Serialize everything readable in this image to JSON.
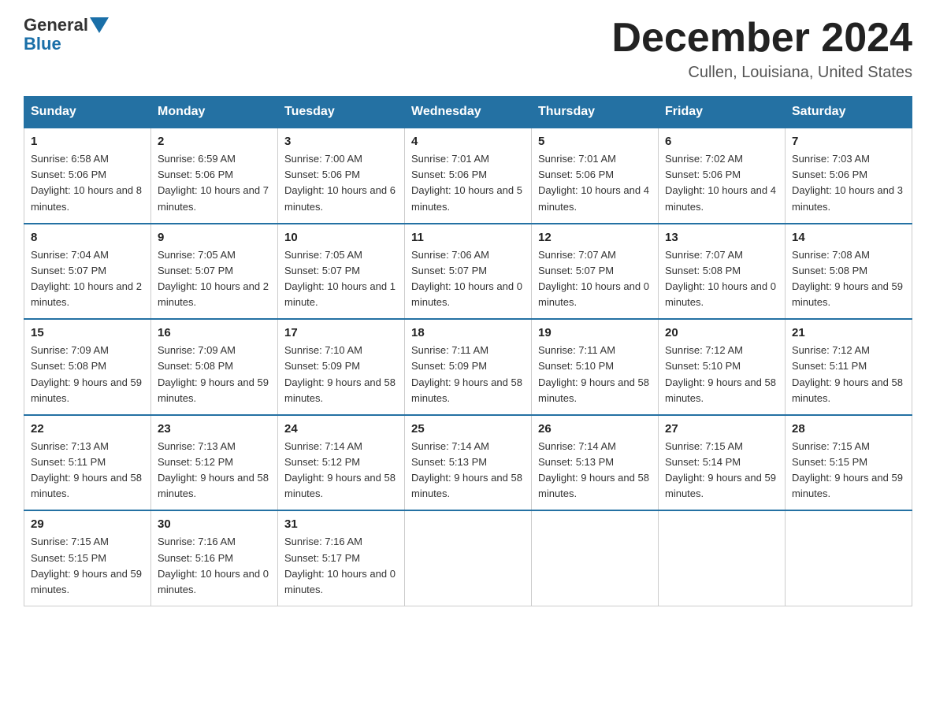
{
  "header": {
    "logo_general": "General",
    "logo_blue": "Blue",
    "title": "December 2024",
    "subtitle": "Cullen, Louisiana, United States"
  },
  "days_of_week": [
    "Sunday",
    "Monday",
    "Tuesday",
    "Wednesday",
    "Thursday",
    "Friday",
    "Saturday"
  ],
  "weeks": [
    [
      {
        "day": "1",
        "sunrise": "6:58 AM",
        "sunset": "5:06 PM",
        "daylight": "10 hours and 8 minutes."
      },
      {
        "day": "2",
        "sunrise": "6:59 AM",
        "sunset": "5:06 PM",
        "daylight": "10 hours and 7 minutes."
      },
      {
        "day": "3",
        "sunrise": "7:00 AM",
        "sunset": "5:06 PM",
        "daylight": "10 hours and 6 minutes."
      },
      {
        "day": "4",
        "sunrise": "7:01 AM",
        "sunset": "5:06 PM",
        "daylight": "10 hours and 5 minutes."
      },
      {
        "day": "5",
        "sunrise": "7:01 AM",
        "sunset": "5:06 PM",
        "daylight": "10 hours and 4 minutes."
      },
      {
        "day": "6",
        "sunrise": "7:02 AM",
        "sunset": "5:06 PM",
        "daylight": "10 hours and 4 minutes."
      },
      {
        "day": "7",
        "sunrise": "7:03 AM",
        "sunset": "5:06 PM",
        "daylight": "10 hours and 3 minutes."
      }
    ],
    [
      {
        "day": "8",
        "sunrise": "7:04 AM",
        "sunset": "5:07 PM",
        "daylight": "10 hours and 2 minutes."
      },
      {
        "day": "9",
        "sunrise": "7:05 AM",
        "sunset": "5:07 PM",
        "daylight": "10 hours and 2 minutes."
      },
      {
        "day": "10",
        "sunrise": "7:05 AM",
        "sunset": "5:07 PM",
        "daylight": "10 hours and 1 minute."
      },
      {
        "day": "11",
        "sunrise": "7:06 AM",
        "sunset": "5:07 PM",
        "daylight": "10 hours and 0 minutes."
      },
      {
        "day": "12",
        "sunrise": "7:07 AM",
        "sunset": "5:07 PM",
        "daylight": "10 hours and 0 minutes."
      },
      {
        "day": "13",
        "sunrise": "7:07 AM",
        "sunset": "5:08 PM",
        "daylight": "10 hours and 0 minutes."
      },
      {
        "day": "14",
        "sunrise": "7:08 AM",
        "sunset": "5:08 PM",
        "daylight": "9 hours and 59 minutes."
      }
    ],
    [
      {
        "day": "15",
        "sunrise": "7:09 AM",
        "sunset": "5:08 PM",
        "daylight": "9 hours and 59 minutes."
      },
      {
        "day": "16",
        "sunrise": "7:09 AM",
        "sunset": "5:08 PM",
        "daylight": "9 hours and 59 minutes."
      },
      {
        "day": "17",
        "sunrise": "7:10 AM",
        "sunset": "5:09 PM",
        "daylight": "9 hours and 58 minutes."
      },
      {
        "day": "18",
        "sunrise": "7:11 AM",
        "sunset": "5:09 PM",
        "daylight": "9 hours and 58 minutes."
      },
      {
        "day": "19",
        "sunrise": "7:11 AM",
        "sunset": "5:10 PM",
        "daylight": "9 hours and 58 minutes."
      },
      {
        "day": "20",
        "sunrise": "7:12 AM",
        "sunset": "5:10 PM",
        "daylight": "9 hours and 58 minutes."
      },
      {
        "day": "21",
        "sunrise": "7:12 AM",
        "sunset": "5:11 PM",
        "daylight": "9 hours and 58 minutes."
      }
    ],
    [
      {
        "day": "22",
        "sunrise": "7:13 AM",
        "sunset": "5:11 PM",
        "daylight": "9 hours and 58 minutes."
      },
      {
        "day": "23",
        "sunrise": "7:13 AM",
        "sunset": "5:12 PM",
        "daylight": "9 hours and 58 minutes."
      },
      {
        "day": "24",
        "sunrise": "7:14 AM",
        "sunset": "5:12 PM",
        "daylight": "9 hours and 58 minutes."
      },
      {
        "day": "25",
        "sunrise": "7:14 AM",
        "sunset": "5:13 PM",
        "daylight": "9 hours and 58 minutes."
      },
      {
        "day": "26",
        "sunrise": "7:14 AM",
        "sunset": "5:13 PM",
        "daylight": "9 hours and 58 minutes."
      },
      {
        "day": "27",
        "sunrise": "7:15 AM",
        "sunset": "5:14 PM",
        "daylight": "9 hours and 59 minutes."
      },
      {
        "day": "28",
        "sunrise": "7:15 AM",
        "sunset": "5:15 PM",
        "daylight": "9 hours and 59 minutes."
      }
    ],
    [
      {
        "day": "29",
        "sunrise": "7:15 AM",
        "sunset": "5:15 PM",
        "daylight": "9 hours and 59 minutes."
      },
      {
        "day": "30",
        "sunrise": "7:16 AM",
        "sunset": "5:16 PM",
        "daylight": "10 hours and 0 minutes."
      },
      {
        "day": "31",
        "sunrise": "7:16 AM",
        "sunset": "5:17 PM",
        "daylight": "10 hours and 0 minutes."
      },
      null,
      null,
      null,
      null
    ]
  ]
}
